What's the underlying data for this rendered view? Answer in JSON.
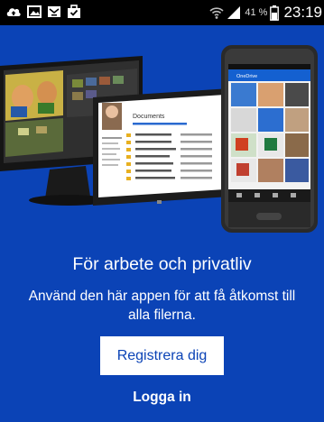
{
  "status_bar": {
    "icons": [
      "cloud-upload-icon",
      "image-icon",
      "mail-icon",
      "briefcase-icon",
      "wifi-icon",
      "signal-icon",
      "battery-icon"
    ],
    "battery_percent": "41 %",
    "time": "23:19"
  },
  "hero": {
    "tablet_doc_title": "Documents",
    "phone_app_name": "OneDrive"
  },
  "onboarding": {
    "headline": "För arbete och privatliv",
    "description": "Använd den här appen för att få åtkomst till alla filerna.",
    "register_label": "Registrera dig",
    "login_label": "Logga in"
  },
  "colors": {
    "background": "#0b43b6",
    "button_bg": "#ffffff",
    "button_text": "#0b43b6"
  }
}
